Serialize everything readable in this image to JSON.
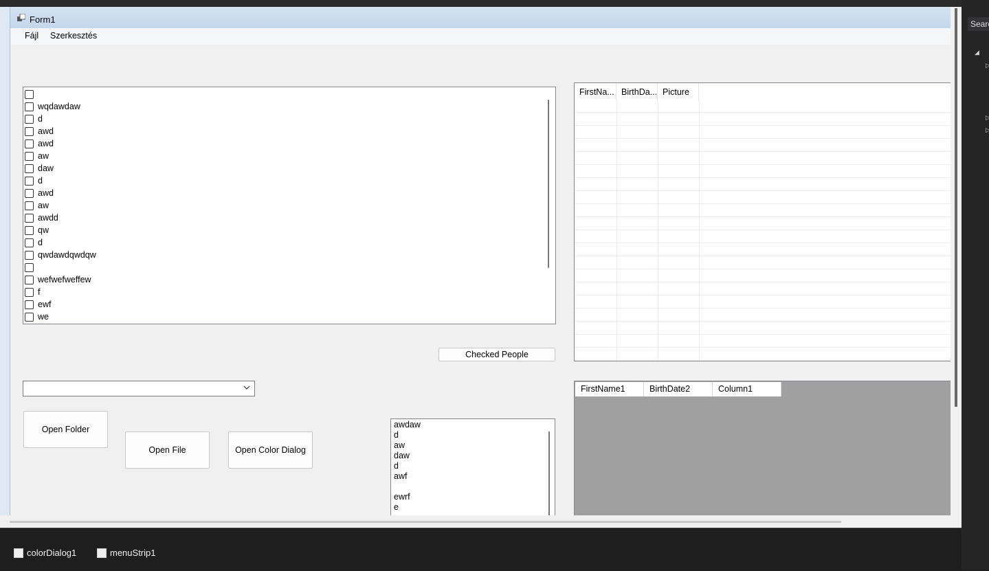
{
  "window": {
    "title": "Form1"
  },
  "menu": [
    "Fájl",
    "Szerkesztés"
  ],
  "checklist": {
    "items": [
      "",
      "wqdawdaw",
      "d",
      "awd",
      "awd",
      "aw",
      "daw",
      "d",
      "awd",
      "aw",
      "awdd",
      "qw",
      "d",
      "qwdawdqwdqw",
      "",
      "wefwefweffew",
      "f",
      "ewf",
      "we"
    ]
  },
  "buttons": {
    "checked_people": "Checked People",
    "open_folder": "Open Folder",
    "open_file": "Open File",
    "open_color_dialog": "Open Color Dialog"
  },
  "combo": {
    "value": ""
  },
  "listbox": {
    "items": [
      "awdaw",
      "d",
      "aw",
      "daw",
      "d",
      "awf",
      "",
      "ewrf",
      "e"
    ]
  },
  "listview": {
    "columns": [
      "FirstNa...",
      "BirthDa...",
      "Picture"
    ]
  },
  "grid": {
    "columns": [
      "FirstName1",
      "BirthDate2",
      "Column1"
    ]
  },
  "side": {
    "search": "Searc"
  },
  "tray": {
    "items": [
      "colorDialog1",
      "menuStrip1"
    ]
  }
}
